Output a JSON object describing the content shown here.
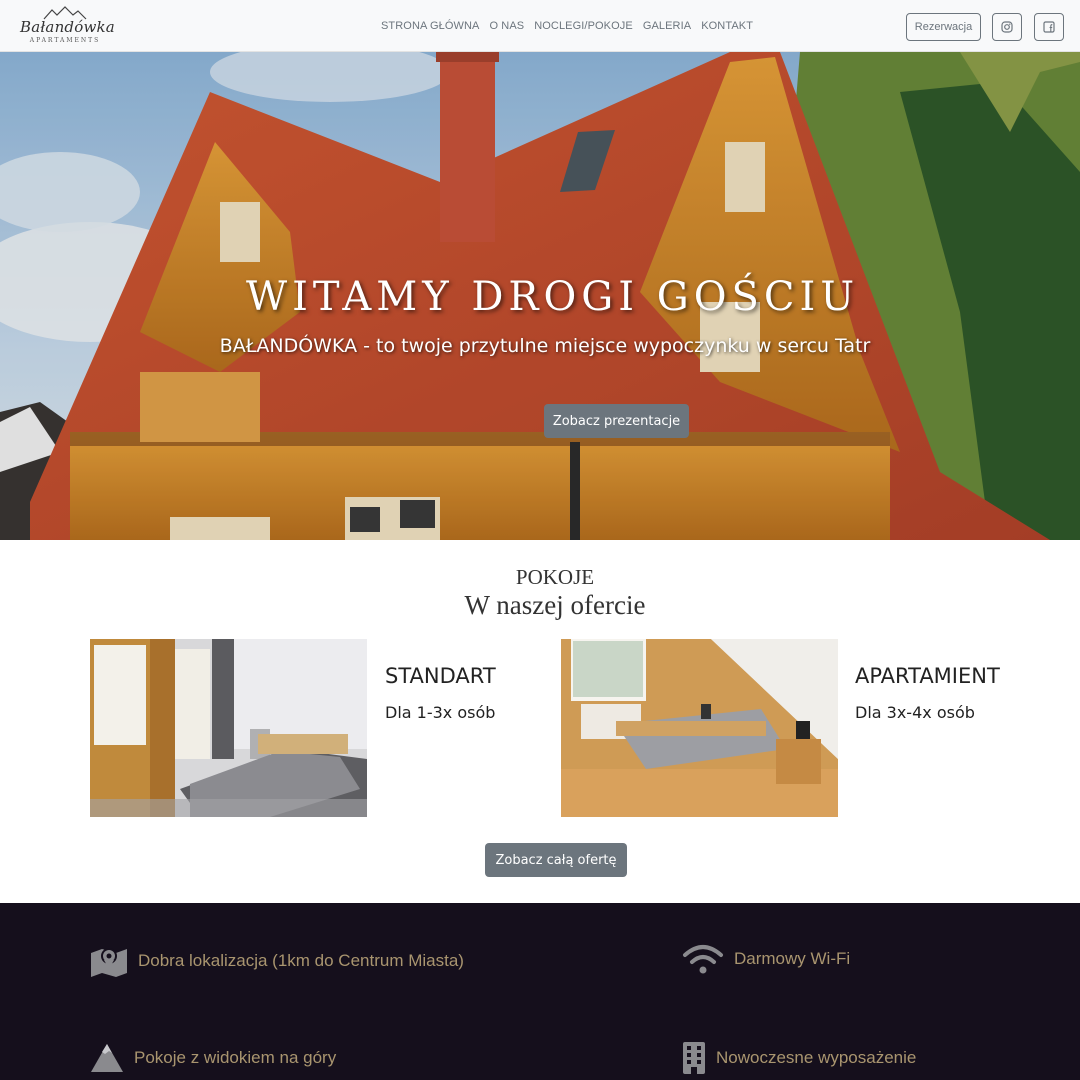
{
  "brand": {
    "name": "Bałandówka",
    "subtitle": "APARTAMENTS"
  },
  "nav": {
    "items": [
      "STRONA GŁÓWNA",
      "O NAS",
      "NOCLEGI/POKOJE",
      "GALERIA",
      "KONTAKT"
    ],
    "reservation": "Rezerwacja",
    "social": [
      "instagram-icon",
      "facebook-icon"
    ]
  },
  "hero": {
    "title": "WITAMY DROGI GOŚCIU",
    "subtitle": "BAŁANDÓWKA - to twoje przytulne miejsce wypoczynku w sercu Tatr",
    "button": "Zobacz prezentacje"
  },
  "rooms": {
    "eyebrow": "POKOJE",
    "title": "W naszej ofercie",
    "items": [
      {
        "name": "STANDART",
        "capacity": "Dla 1-3x osób"
      },
      {
        "name": "APARTAMIENT",
        "capacity": "Dla 3x-4x osób"
      }
    ],
    "button": "Zobacz całą ofertę"
  },
  "features": [
    {
      "icon": "map-pin-icon",
      "label": "Dobra lokalizacja (1km do Centrum Miasta)"
    },
    {
      "icon": "wifi-icon",
      "label": "Darmowy Wi-Fi"
    },
    {
      "icon": "mountain-icon",
      "label": "Pokoje z widokiem na góry"
    },
    {
      "icon": "building-icon",
      "label": "Nowoczesne wyposażenie"
    }
  ],
  "colors": {
    "nav_bg": "#f8f9fa",
    "button_bg": "#6c757d",
    "features_bg": "#150f1c",
    "features_text": "#a9956f",
    "roof": "#c8502f",
    "wood": "#d9922f"
  }
}
